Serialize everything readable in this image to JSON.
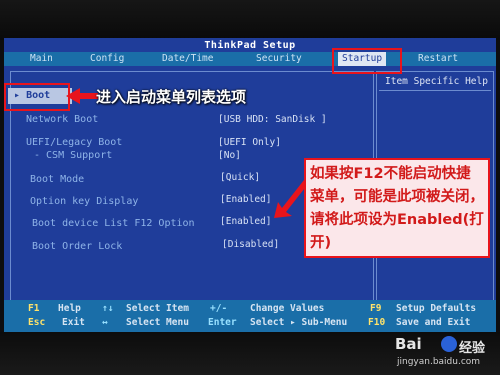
{
  "window": {
    "title": "ThinkPad Setup"
  },
  "menu": {
    "tabs": [
      {
        "label": "Main"
      },
      {
        "label": "Config"
      },
      {
        "label": "Date/Time"
      },
      {
        "label": "Security"
      },
      {
        "label": "Startup"
      },
      {
        "label": "Restart"
      }
    ],
    "active": "Startup"
  },
  "startup": {
    "selected_item": "Boot",
    "items": [
      {
        "label": "Network Boot",
        "value": "[USB HDD: SanDisk ]"
      },
      {
        "label": "UEFI/Legacy Boot",
        "value": "[UEFI Only]"
      },
      {
        "label": "- CSM Support",
        "value": "[No]"
      },
      {
        "label": "Boot Mode",
        "value": "[Quick]"
      },
      {
        "label": "Option key Display",
        "value": "[Enabled]"
      },
      {
        "label": "Boot device List F12 Option",
        "value": "[Enabled]"
      },
      {
        "label": "Boot Order Lock",
        "value": "[Disabled]"
      }
    ]
  },
  "help_panel": {
    "title": "Item Specific Help"
  },
  "annotations": {
    "callout_boot": "进入启动菜单列表选项",
    "callout_f12": "如果按F12不能启动快捷菜单，可能是此项被关闭，请将此项设为Enabled(打开)"
  },
  "footer": {
    "row1": [
      {
        "key": "F1",
        "action": "Help"
      },
      {
        "key": "↑↓",
        "action": "Select Item"
      },
      {
        "key": "+/-",
        "action": "Change Values"
      },
      {
        "key": "F9",
        "action": "Setup Defaults"
      }
    ],
    "row2": [
      {
        "key": "Esc",
        "action": "Exit"
      },
      {
        "key": "↔",
        "action": "Select Menu"
      },
      {
        "key": "Enter",
        "action": "Select ▸ Sub-Menu"
      },
      {
        "key": "F10",
        "action": "Save and Exit"
      }
    ]
  },
  "watermark": {
    "brand": "Bai",
    "brand_suffix": "经验",
    "url": "jingyan.baidu.com"
  },
  "colors": {
    "bios_blue": "#1f3d9a",
    "bar_blue": "#1a6ea8",
    "highlight": "#e8141c",
    "callout_bg": "#fbe7ea"
  }
}
